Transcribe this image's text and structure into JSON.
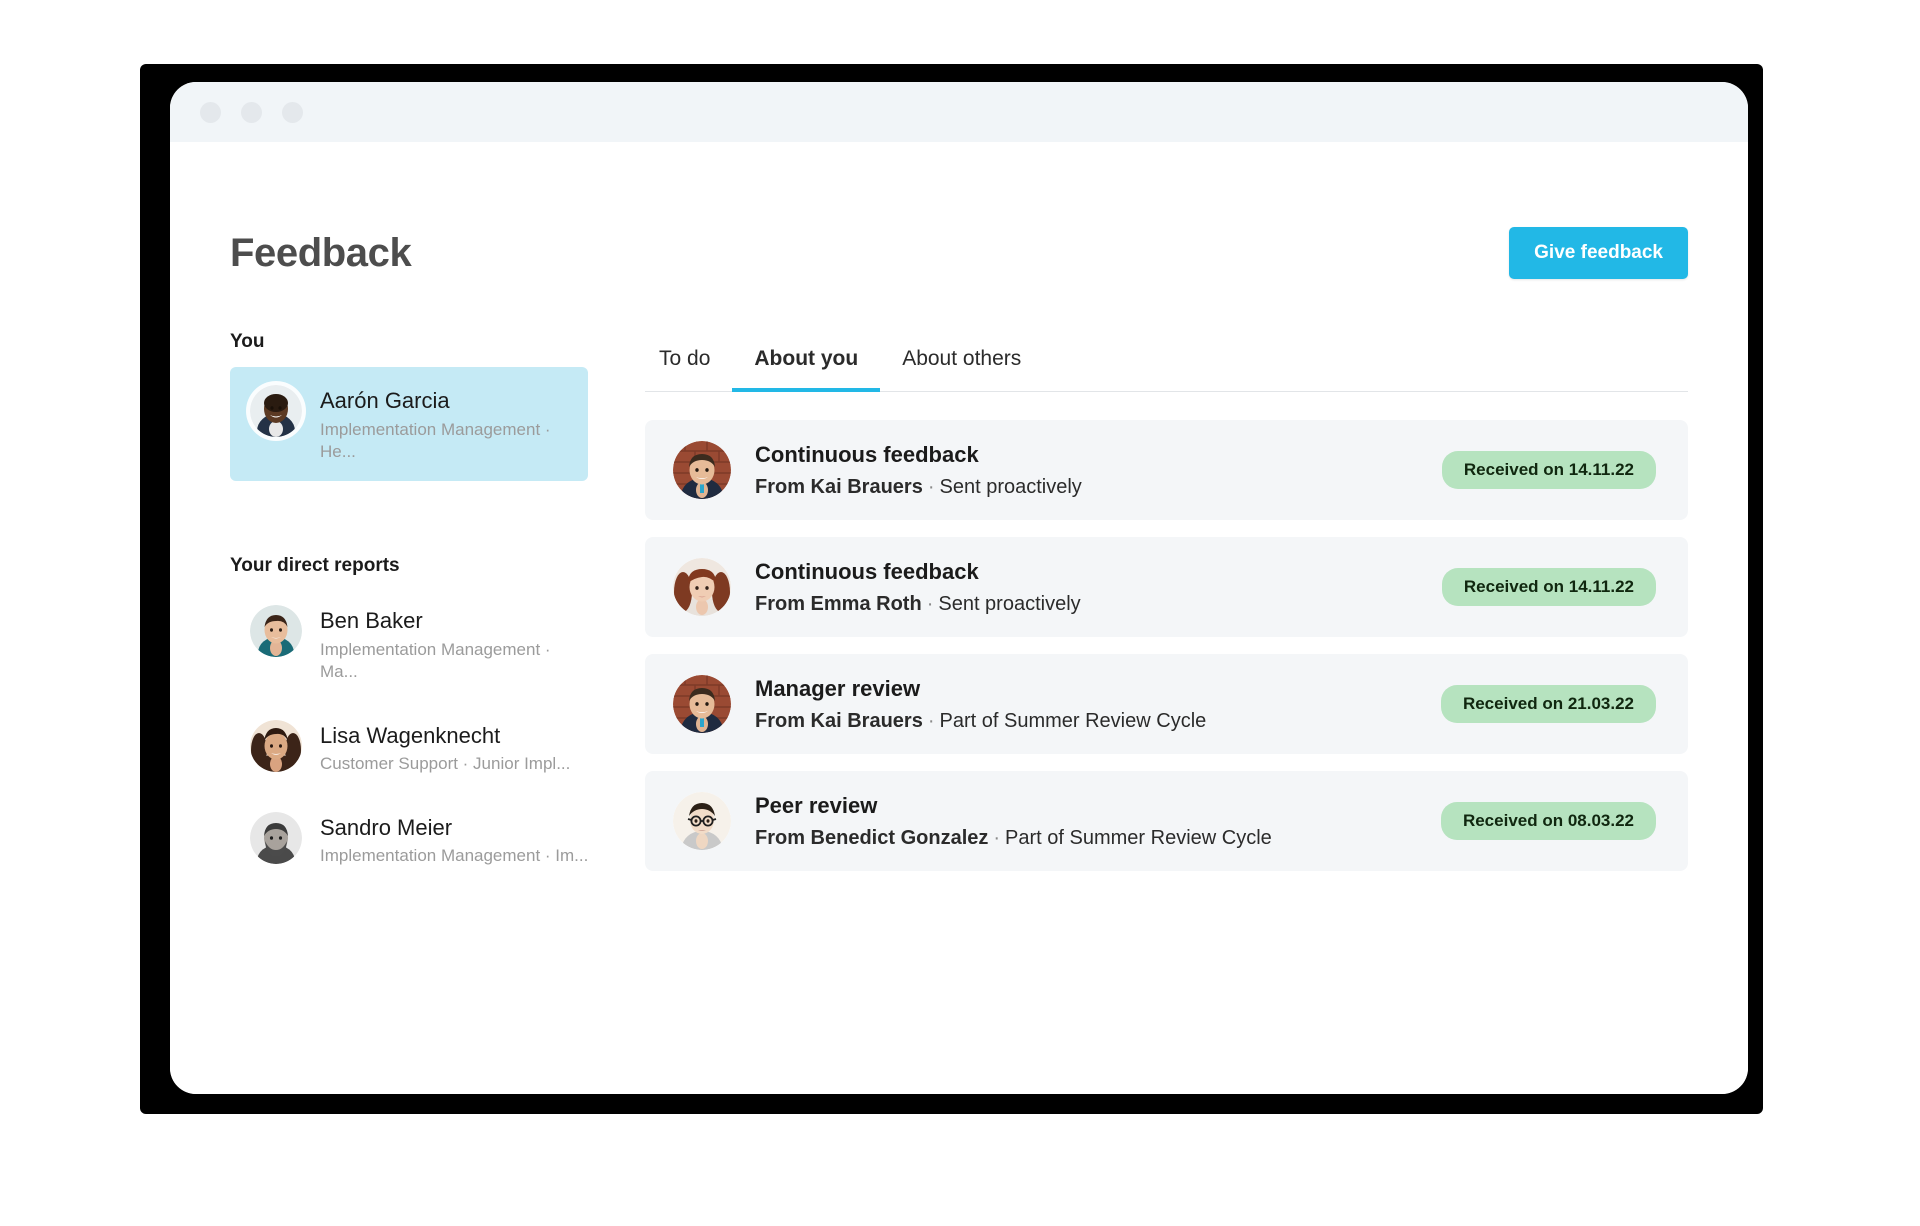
{
  "window": {
    "traffic_lights": [
      "close",
      "minimize",
      "maximize"
    ]
  },
  "header": {
    "title": "Feedback",
    "primary_action": "Give feedback",
    "accent_color": "#22b8e6"
  },
  "sidebar": {
    "you_label": "You",
    "you": {
      "name": "Aarón Garcia",
      "role": "Implementation Management · He...",
      "selected": true,
      "highlight_color": "#c5eaf5",
      "avatar": "avatar-aaron-garcia"
    },
    "reports_label": "Your direct reports",
    "reports": [
      {
        "name": "Ben Baker",
        "role": "Implementation Management · Ma...",
        "avatar": "avatar-ben-baker"
      },
      {
        "name": "Lisa Wagenknecht",
        "role": "Customer Support · Junior Impl...",
        "avatar": "avatar-lisa-wagenknecht"
      },
      {
        "name": "Sandro Meier",
        "role": "Implementation Management · Im...",
        "avatar": "avatar-sandro-meier"
      }
    ]
  },
  "main": {
    "tabs": [
      {
        "label": "To do",
        "active": false
      },
      {
        "label": "About you",
        "active": true
      },
      {
        "label": "About others",
        "active": false
      }
    ],
    "feedback_items": [
      {
        "title": "Continuous feedback",
        "from": "From Kai Brauers",
        "separator": "·",
        "context": "Sent proactively",
        "badge": "Received on 14.11.22",
        "badge_color": "#b6e3bf",
        "avatar": "avatar-kai-brauers"
      },
      {
        "title": "Continuous feedback",
        "from": "From Emma Roth",
        "separator": "·",
        "context": "Sent proactively",
        "badge": "Received on 14.11.22",
        "badge_color": "#b6e3bf",
        "avatar": "avatar-emma-roth"
      },
      {
        "title": "Manager review",
        "from": "From Kai Brauers",
        "separator": "·",
        "context": "Part of Summer Review Cycle",
        "badge": "Received on 21.03.22",
        "badge_color": "#b6e3bf",
        "avatar": "avatar-kai-brauers"
      },
      {
        "title": "Peer review",
        "from": "From Benedict Gonzalez",
        "separator": "·",
        "context": "Part of Summer Review Cycle",
        "badge": "Received on 08.03.22",
        "badge_color": "#b6e3bf",
        "avatar": "avatar-benedict-gonzalez"
      }
    ]
  }
}
